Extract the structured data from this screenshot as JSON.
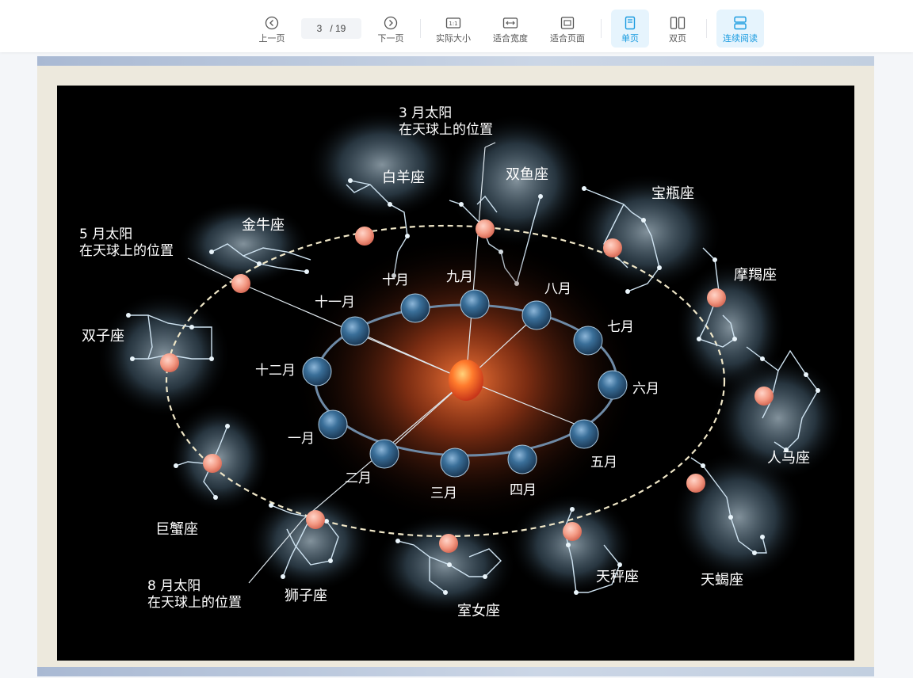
{
  "toolbar": {
    "prev_label": "上一页",
    "next_label": "下一页",
    "current_page": "3",
    "total_pages": "/ 19",
    "actual_size_label": "实际大小",
    "fit_width_label": "适合宽度",
    "fit_page_label": "适合页面",
    "single_page_label": "单页",
    "double_page_label": "双页",
    "continuous_label": "连续阅读",
    "accent_color": "#1a9be0"
  },
  "slide": {
    "constellations": {
      "aries": "白羊座",
      "pisces": "双鱼座",
      "aquarius": "宝瓶座",
      "taurus": "金牛座",
      "capricorn": "摩羯座",
      "gemini": "双子座",
      "sagittarius": "人马座",
      "cancer": "巨蟹座",
      "scorpio": "天蝎座",
      "libra": "天秤座",
      "leo": "狮子座",
      "virgo": "室女座"
    },
    "months": {
      "sep": "九月",
      "oct": "十月",
      "aug": "八月",
      "nov": "十一月",
      "jul": "七月",
      "dec": "十二月",
      "jun": "六月",
      "jan": "一月",
      "may": "五月",
      "feb": "二月",
      "mar": "三月",
      "apr": "四月"
    },
    "annotations": {
      "march_line1": "3 月太阳",
      "march_line2": "在天球上的位置",
      "may_line1": "5 月太阳",
      "may_line2": "在天球上的位置",
      "aug_line1": "8 月太阳",
      "aug_line2": "在天球上的位置"
    }
  }
}
